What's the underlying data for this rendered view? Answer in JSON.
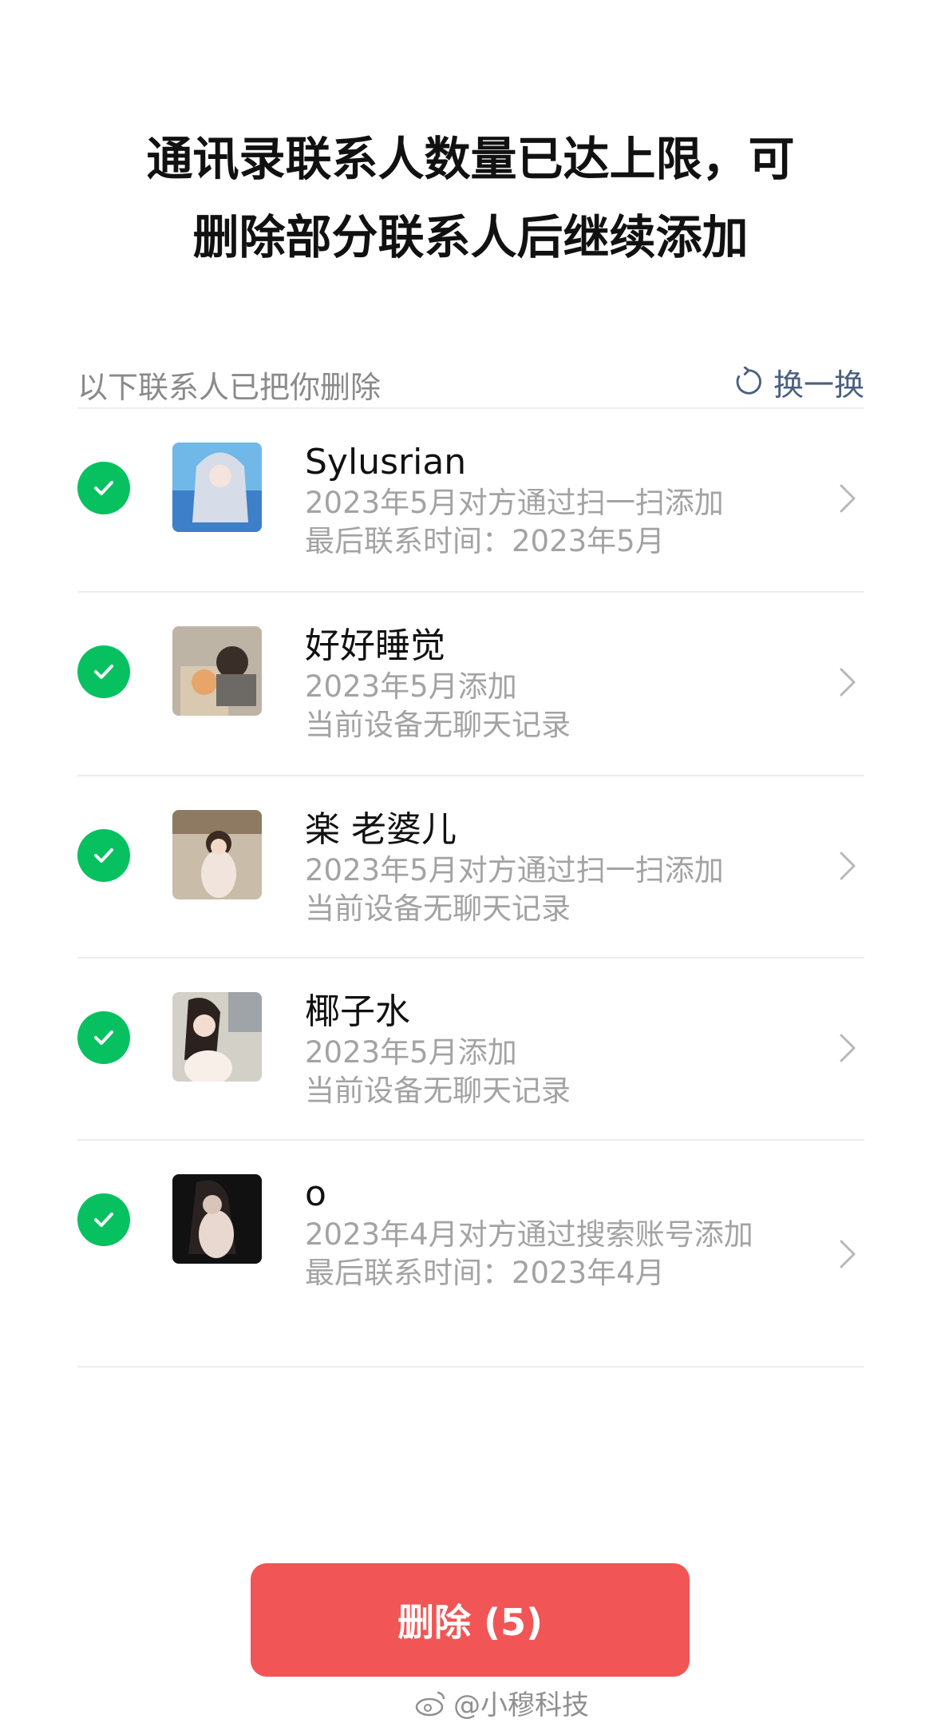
{
  "title": {
    "line1": "通讯录联系人数量已达上限，可",
    "line2": "删除部分联系人后继续添加"
  },
  "section": {
    "label": "以下联系人已把你删除",
    "refresh_label": "换一换"
  },
  "contacts": [
    {
      "name": "Sylusrian",
      "line1": "2023年5月对方通过扫一扫添加",
      "line2": "最后联系时间：2023年5月",
      "checked": true
    },
    {
      "name": "好好睡觉",
      "line1": "2023年5月添加",
      "line2": "当前设备无聊天记录",
      "checked": true
    },
    {
      "name": "楽 老婆儿",
      "line1": "2023年5月对方通过扫一扫添加",
      "line2": "当前设备无聊天记录",
      "checked": true
    },
    {
      "name": "椰子水",
      "line1": "2023年5月添加",
      "line2": "当前设备无聊天记录",
      "checked": true
    },
    {
      "name": "o",
      "line1": "2023年4月对方通过搜索账号添加",
      "line2": "最后联系时间：2023年4月",
      "checked": true
    }
  ],
  "delete_button": "删除 (5)",
  "watermark": "@小穆科技",
  "colors": {
    "check_green": "#07c160",
    "delete_red": "#f25555",
    "link_blue": "#4a5f80",
    "muted_text": "#a3a3a3"
  }
}
